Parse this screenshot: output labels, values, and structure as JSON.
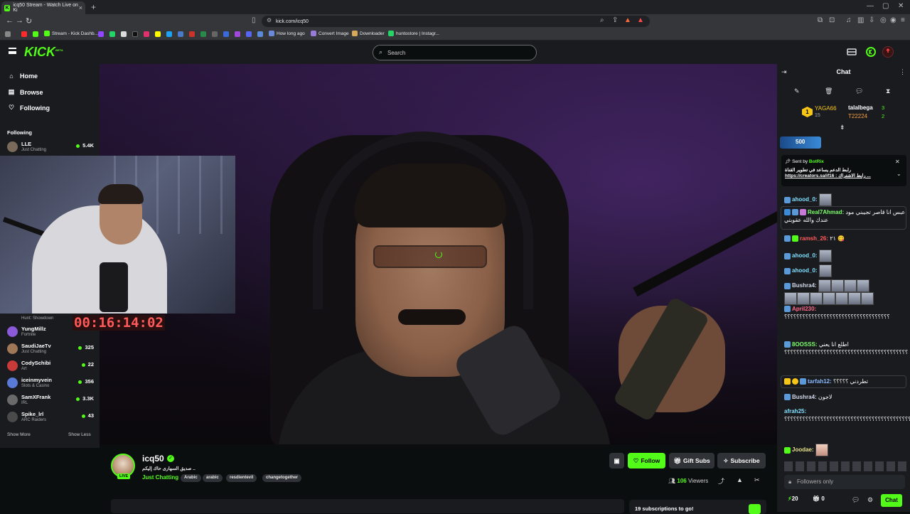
{
  "browser": {
    "tab_title": "icq50 Stream - Watch Live on Ki",
    "url": "kick.com/icq50",
    "bookmarks": [
      "Stream - Kick Dashb...",
      "How long ago",
      "Convert Image",
      "Downloader",
      "huntostore | Instagr..."
    ]
  },
  "header": {
    "logo": "KICK",
    "logo_sup": "BETA",
    "search_placeholder": "Search"
  },
  "sidebar": {
    "nav": [
      {
        "label": "Home",
        "icon": "home-icon"
      },
      {
        "label": "Browse",
        "icon": "browse-icon"
      },
      {
        "label": "Following",
        "icon": "heart-icon"
      }
    ],
    "following_title": "Following",
    "channels": [
      {
        "name": "LLE",
        "category": "Just Chatting",
        "viewers": "5.4K"
      },
      {
        "name": "YungMillz",
        "category": "Fortnite",
        "viewers": ""
      },
      {
        "name": "SaudiJaeTv",
        "category": "Just Chatting",
        "viewers": "325"
      },
      {
        "name": "CodySchibi",
        "category": "Art",
        "viewers": "22"
      },
      {
        "name": "iceinmyvein",
        "category": "Slots & Casino",
        "viewers": "356"
      },
      {
        "name": "SamXFrank",
        "category": "IRL",
        "viewers": "3.3K"
      },
      {
        "name": "Spike_lrl",
        "category": "ARC Raiders",
        "viewers": "43"
      }
    ],
    "hidden_category": "Hunt: Showdown",
    "show_more": "Show More",
    "show_less": "Show Less"
  },
  "video": {
    "timer": "00:16:14:02"
  },
  "channel": {
    "name": "icq50",
    "live_badge": "LIVE",
    "stream_title": "صديق السهارى حاك إليكم ..",
    "category": "Just Chatting",
    "tags": [
      "Arabic",
      "arabic",
      "resdientevil",
      "changetogether"
    ],
    "follow_label": "Follow",
    "gift_label": "Gift Subs",
    "subscribe_label": "Subscribe",
    "viewers_count": "106",
    "viewers_label": "Viewers",
    "sub_goal": "19 subscriptions to go!"
  },
  "chat": {
    "title": "Chat",
    "leaderboard": [
      {
        "rank": "1",
        "name": "YAGA66",
        "count": "15"
      },
      {
        "name": "talalbega",
        "count": "3"
      },
      {
        "name": "T22224",
        "count": "2"
      }
    ],
    "kicks_badge": "500",
    "pinned_sent_by": "Sent by",
    "pinned_bot": "BotRix",
    "pinned_line1": "رابط الدعم يساعد في تطوير القناة",
    "pinned_line2": "https://creators.sa/if16 : رابط الاشتراك ...",
    "messages": [
      {
        "user": "ahood_0:",
        "text": "",
        "color": "#7fe0ff"
      },
      {
        "user": "Real7Ahmad:",
        "text": "عبس انا قاصر تجيبني مود عندك والله عقوبتي",
        "color": "#7cff6a"
      },
      {
        "user": "ramsh_26:",
        "text": "٢١ 😋",
        "color": "#ff5a5a"
      },
      {
        "user": "ahood_0:",
        "text": "",
        "color": "#7fe0ff"
      },
      {
        "user": "ahood_0:",
        "text": "",
        "color": "#7fe0ff"
      },
      {
        "user": "Bushra4:",
        "text": "",
        "color": "#d0d8e8"
      },
      {
        "user": "April230:",
        "text": "؟؟؟؟؟؟؟؟؟؟؟؟؟؟؟؟؟؟؟؟؟؟؟؟؟؟؟؟؟؟؟؟؟؟؟",
        "color": "#ff6a8a"
      },
      {
        "user": "8OOSSS:",
        "text": "اطلع انا يعني ؟؟؟؟؟؟؟؟؟؟؟؟؟؟؟؟؟؟؟؟؟؟؟؟؟؟؟؟؟؟؟؟؟؟؟؟؟؟؟؟؟",
        "color": "#7cff6a"
      },
      {
        "user": "tarfah12:",
        "text": "تطردني ؟؟؟؟؟",
        "color": "#8ab8ff"
      },
      {
        "user": "Bushra4:",
        "text": "لاجون",
        "color": "#d0d8e8"
      },
      {
        "user": "afrah25:",
        "text": "؟؟؟؟؟؟؟؟؟؟؟؟؟؟؟؟؟؟؟؟؟؟؟؟؟؟؟؟؟؟؟؟؟؟؟؟؟؟؟؟؟؟؟؟؟؟",
        "color": "#7fe0ff"
      },
      {
        "user": "Joodae:",
        "text": "",
        "color": "#e8e088"
      }
    ],
    "followers_only": "Followers only",
    "kicks_count": "20",
    "gifts_count": "0",
    "send_label": "Chat"
  }
}
